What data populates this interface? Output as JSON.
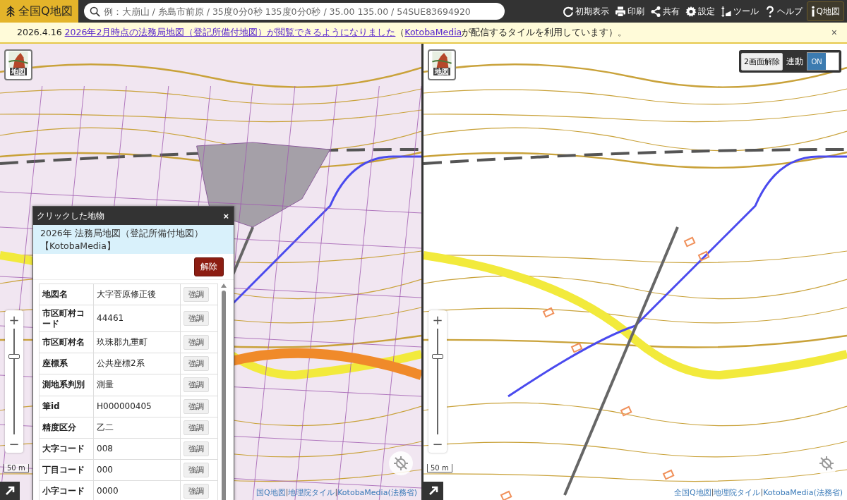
{
  "header": {
    "logo": "全国Q地図",
    "search": {
      "placeholder": "例：大崩山 / 糸島市前原 / 35度0分0秒 135度0分0秒 / 35.00 135.00 / 54SUE83694920"
    },
    "tools": [
      {
        "kind": "reset",
        "label": "初期表示"
      },
      {
        "kind": "print",
        "label": "印刷"
      },
      {
        "kind": "share",
        "label": "共有"
      },
      {
        "kind": "settings",
        "label": "設定"
      },
      {
        "kind": "tools",
        "label": "ツール"
      },
      {
        "kind": "help",
        "label": "ヘルプ"
      },
      {
        "kind": "info",
        "label": "Q地図"
      }
    ]
  },
  "notice": {
    "date": "2026.4.16",
    "link": "2026年2月時点の法務局地図（登記所備付地図）が閲覧できるようになりました",
    "open": "（",
    "source_link": "KotobaMedia",
    "rest": "が配信するタイルを利用しています）。",
    "close": "×"
  },
  "panes": [
    {
      "kind": "parcels",
      "layer_button": "地図",
      "zoom": {
        "plus": "+",
        "minus": "−",
        "level": 0.74
      },
      "scale": "50 m",
      "attribution": {
        "separator": "|",
        "links": [
          "国Q地図",
          "地理院タイル",
          "KotobaMedia(法務省)"
        ]
      },
      "popup": {
        "title": "クリックした地物",
        "close": "×",
        "subtitle": "2026年 法務局地図（登記所備付地図）【KotobaMedia】",
        "clear_button": "解除",
        "rows": [
          {
            "label": "地図名",
            "value": "大字菅原修正後",
            "button": "強調"
          },
          {
            "label": "市区町村コード",
            "value": "44461",
            "button": "強調"
          },
          {
            "label": "市区町村名",
            "value": "玖珠郡九重町",
            "button": "強調"
          },
          {
            "label": "座標系",
            "value": "公共座標2系",
            "button": "強調"
          },
          {
            "label": "測地系判別",
            "value": "測量",
            "button": "強調"
          },
          {
            "label": "筆id",
            "value": "H000000405",
            "button": "強調"
          },
          {
            "label": "精度区分",
            "value": "乙二",
            "button": "強調"
          },
          {
            "label": "大字コード",
            "value": "008",
            "button": "強調"
          },
          {
            "label": "丁目コード",
            "value": "000",
            "button": "強調"
          },
          {
            "label": "小字コード",
            "value": "0000",
            "button": "強調"
          }
        ]
      }
    },
    {
      "kind": "topo",
      "layer_button": "地図",
      "split": {
        "button": "2画面解除",
        "label": "連動",
        "toggle": "ON",
        "on": true
      },
      "zoom": {
        "plus": "+",
        "minus": "−",
        "level": 0.74
      },
      "scale": "50 m",
      "attribution": {
        "separator": "|",
        "links": [
          "全国Q地図",
          "地理院タイル",
          "KotobaMedia(法務省)"
        ]
      }
    }
  ]
}
